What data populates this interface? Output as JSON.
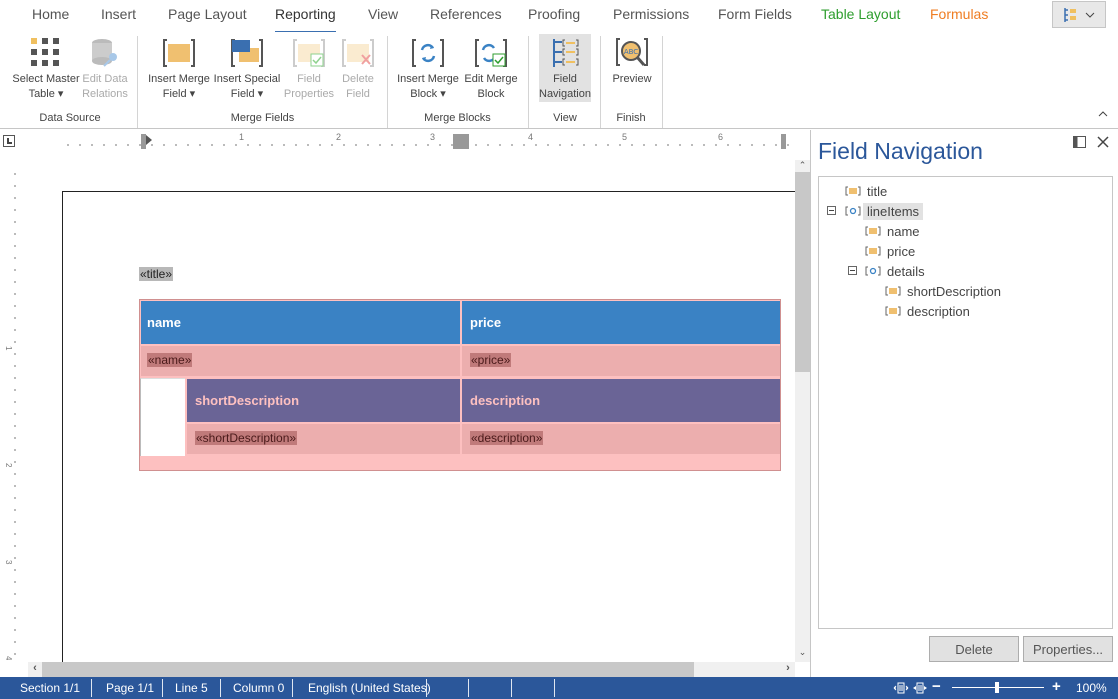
{
  "tabs": [
    {
      "label": "Home"
    },
    {
      "label": "Insert"
    },
    {
      "label": "Page Layout"
    },
    {
      "label": "Reporting",
      "active": true
    },
    {
      "label": "View"
    },
    {
      "label": "References"
    },
    {
      "label": "Proofing"
    },
    {
      "label": "Permissions"
    },
    {
      "label": "Form Fields"
    },
    {
      "label": "Table Layout",
      "color": "#2e9e2e"
    },
    {
      "label": "Formulas",
      "color": "#ef7d22"
    }
  ],
  "ribbon": {
    "groups": [
      {
        "label": "Data Source"
      },
      {
        "label": "Merge Fields"
      },
      {
        "label": "Merge Blocks"
      },
      {
        "label": "View"
      },
      {
        "label": "Finish"
      }
    ],
    "buttons": {
      "select_master_table": {
        "line1": "Select Master",
        "line2": "Table ▾"
      },
      "edit_data_relations": {
        "line1": "Edit Data",
        "line2": "Relations"
      },
      "insert_merge_field": {
        "line1": "Insert Merge",
        "line2": "Field ▾"
      },
      "insert_special_field": {
        "line1": "Insert Special",
        "line2": "Field ▾"
      },
      "field_properties": {
        "line1": "Field",
        "line2": "Properties"
      },
      "delete_field": {
        "line1": "Delete",
        "line2": "Field"
      },
      "insert_merge_block": {
        "line1": "Insert Merge",
        "line2": "Block ▾"
      },
      "edit_merge_block": {
        "line1": "Edit Merge",
        "line2": "Block"
      },
      "field_navigation": {
        "line1": "Field",
        "line2": "Navigation"
      },
      "preview": {
        "line1": "Preview",
        "line2": ""
      }
    }
  },
  "ruler": {
    "labels": [
      "1",
      "2",
      "3",
      "4",
      "5",
      "6"
    ]
  },
  "vruler": {
    "labels": [
      "1",
      "2",
      "3",
      "4"
    ]
  },
  "document": {
    "title_field": "«title»",
    "table": {
      "header": [
        "name",
        "price"
      ],
      "row": [
        "«name»",
        "«price»"
      ],
      "detail_header": [
        "shortDescription",
        "description"
      ],
      "detail_row": [
        "«shortDescription»",
        "«description»"
      ]
    },
    "colors": {
      "header": "#3a82c4",
      "detail_header": "#6a6496",
      "row": "#ecaeae",
      "outer": "#fdc0c0"
    }
  },
  "panel": {
    "title": "Field Navigation",
    "tree": [
      {
        "label": "title",
        "type": "field",
        "level": 0
      },
      {
        "label": "lineItems",
        "type": "block",
        "level": 0,
        "expanded": true,
        "selected": true
      },
      {
        "label": "name",
        "type": "field",
        "level": 1
      },
      {
        "label": "price",
        "type": "field",
        "level": 1
      },
      {
        "label": "details",
        "type": "block",
        "level": 1,
        "expanded": true
      },
      {
        "label": "shortDescription",
        "type": "field",
        "level": 2
      },
      {
        "label": "description",
        "type": "field",
        "level": 2
      }
    ],
    "delete_label": "Delete",
    "properties_label": "Properties..."
  },
  "status": {
    "section": "Section 1/1",
    "page": "Page 1/1",
    "line": "Line 5",
    "column": "Column 0",
    "language": "English (United States)",
    "zoom": "100%",
    "zoom_level": 1.0
  }
}
